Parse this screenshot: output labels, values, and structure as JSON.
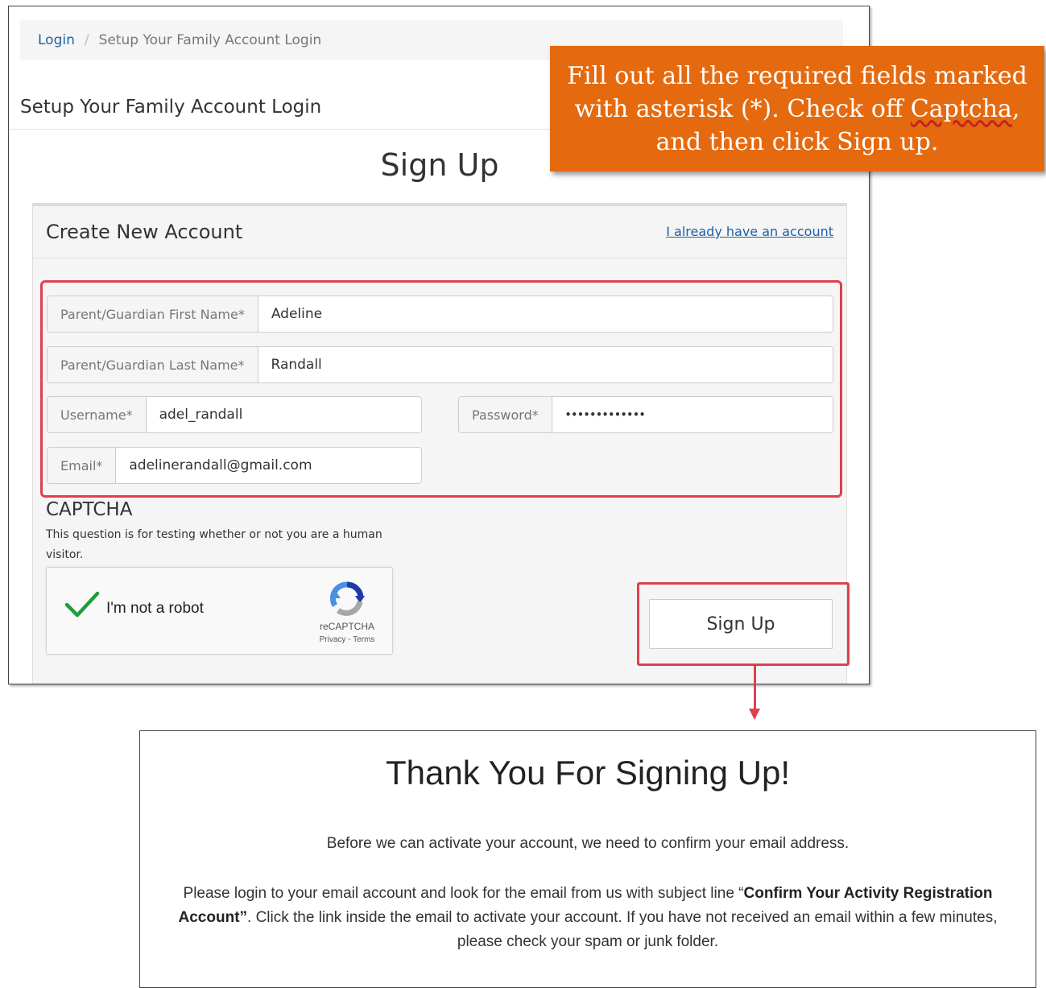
{
  "breadcrumb": {
    "login": "Login",
    "separator": "/",
    "current": "Setup Your Family Account Login"
  },
  "page_heading": "Setup Your Family Account Login",
  "signup_title": "Sign Up",
  "panel": {
    "title": "Create New Account",
    "already_link": "I already have an account"
  },
  "form": {
    "first_name": {
      "label": "Parent/Guardian First Name*",
      "value": "Adeline"
    },
    "last_name": {
      "label": "Parent/Guardian Last Name*",
      "value": "Randall"
    },
    "username": {
      "label": "Username*",
      "value": "adel_randall"
    },
    "password": {
      "label": "Password*",
      "value": "•••••••••••••"
    },
    "email": {
      "label": "Email*",
      "value": "adelinerandall@gmail.com"
    }
  },
  "captcha": {
    "title": "CAPTCHA",
    "description": "This question is for testing whether or not you are a human visitor.",
    "robot_label": "I'm not a robot",
    "brand": "reCAPTCHA",
    "terms": "Privacy - Terms",
    "checked": true
  },
  "signup_button": "Sign Up",
  "callout": {
    "line1": "Fill out all the required fields marked",
    "line2_pre": "with asterisk (*). Check off ",
    "line2_word": "Captcha",
    "line2_post": ",",
    "line3": "and then click Sign up."
  },
  "thanks": {
    "title": "Thank You For Signing Up!",
    "p1": "Before we can activate your account, we need to confirm your email address.",
    "p2_pre": "Please login to your email account and look for the email from us with subject line “",
    "p2_bold": "Confirm Your Activity Registration Account”",
    "p2_post": ". Click the link inside the email to activate your account. If you have not received an email within a few minutes, please check your spam or junk folder."
  },
  "colors": {
    "callout_bg": "#e56a0f",
    "highlight_red": "#e03f4f",
    "link_blue": "#1f5fa8",
    "check_green": "#1e9e3a"
  }
}
